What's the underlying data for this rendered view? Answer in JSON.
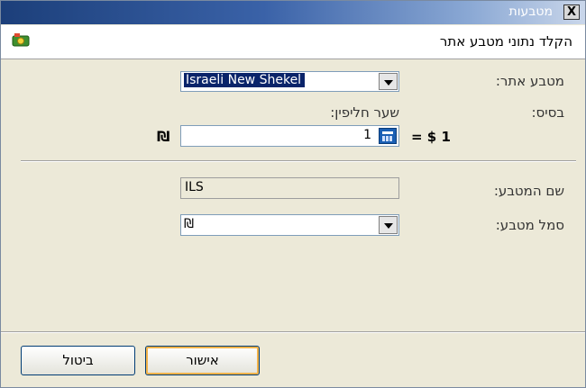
{
  "window": {
    "title": "מטבעות",
    "close_label": "X"
  },
  "header": {
    "title": "הקלד נתוני מטבע אתר"
  },
  "form": {
    "site_currency_label": "מטבע אתר:",
    "site_currency_value": "Israeli New Shekel",
    "base_label": "בסיס:",
    "exchange_rate_label": "שער חליפין:",
    "exchange_rate_value": "1",
    "base_equation": "= $ 1",
    "currency_symbol_suffix": "₪",
    "currency_name_label": "שם המטבע:",
    "currency_name_value": "ILS",
    "currency_symbol_label": "סמל מטבע:",
    "currency_symbol_value": "₪"
  },
  "buttons": {
    "ok": "אישור",
    "cancel": "ביטול"
  },
  "colors": {
    "title_bar": "#1c3f7a",
    "selection": "#0a246a",
    "dialog_bg": "#ece9d8"
  }
}
